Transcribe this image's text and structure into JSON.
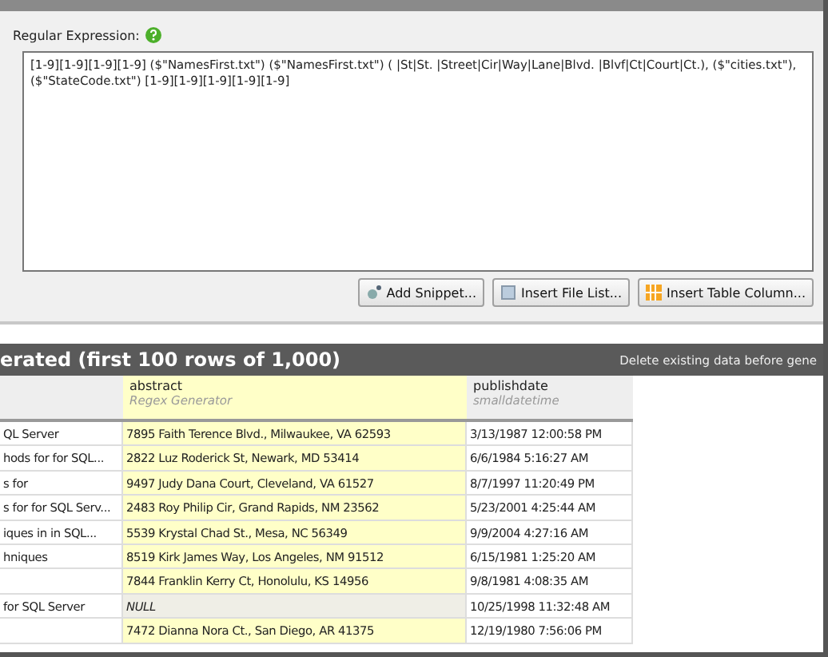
{
  "regex": {
    "label": "Regular Expression:",
    "value": "[1-9][1-9][1-9][1-9] ($\"NamesFirst.txt\") ($\"NamesFirst.txt\") ( |St|St. |Street|Cir|Way|Lane|Blvd. |Blvf|Ct|Court|Ct.), ($\"cities.txt\"), ($\"StateCode.txt\") [1-9][1-9][1-9][1-9][1-9]"
  },
  "buttons": [
    {
      "label": "Add Snippet...",
      "kind": "snippet"
    },
    {
      "label": "Insert File List...",
      "kind": "file"
    },
    {
      "label": "Insert Table  Column...",
      "kind": "table"
    }
  ],
  "preview": {
    "title": "erated (first 100 rows of 1,000)",
    "option": "Delete existing data before gene"
  },
  "columns": [
    {
      "highlighted": false
    },
    {
      "name": "abstract",
      "type": "Regex Generator",
      "highlighted": true
    },
    {
      "name": "publishdate",
      "type": "smalldatetime",
      "highlighted": false
    }
  ],
  "rows": [
    {
      "cells": [
        {
          "text": "QL Server"
        },
        {
          "text": "7895 Faith Terence Blvd., Milwaukee, VA 62593"
        },
        {
          "text": "3/13/1987 12:00:58 PM"
        }
      ]
    },
    {
      "cells": [
        {
          "text": "hods for for SQL..."
        },
        {
          "text": "2822 Luz Roderick St, Newark, MD 53414"
        },
        {
          "text": "6/6/1984 5:16:27 AM"
        }
      ]
    },
    {
      "cells": [
        {
          "text": "s for"
        },
        {
          "text": "9497 Judy Dana Court, Cleveland, VA 61527"
        },
        {
          "text": "8/7/1997 11:20:49 PM"
        }
      ]
    },
    {
      "cells": [
        {
          "text": "s for for SQL Serv..."
        },
        {
          "text": "2483 Roy Philip Cir, Grand Rapids, NM 23562"
        },
        {
          "text": "5/23/2001 4:25:44 AM"
        }
      ]
    },
    {
      "cells": [
        {
          "text": "iques in in SQL..."
        },
        {
          "text": "5539 Krystal Chad St., Mesa, NC 56349"
        },
        {
          "text": "9/9/2004 4:27:16 AM"
        }
      ]
    },
    {
      "cells": [
        {
          "text": "hniques"
        },
        {
          "text": "8519 Kirk James Way, Los Angeles, NM 91512"
        },
        {
          "text": "6/15/1981 1:25:20 AM"
        }
      ]
    },
    {
      "cells": [
        {},
        {
          "text": "7844 Franklin Kerry Ct, Honolulu, KS 14956"
        },
        {
          "text": "9/8/1981 4:08:35 AM"
        }
      ]
    },
    {
      "cells": [
        {
          "text": " for SQL Server"
        },
        {
          "text": "NULL",
          "kind": "null"
        },
        {
          "text": "10/25/1998 11:32:48 AM"
        }
      ]
    },
    {
      "cells": [
        {},
        {
          "text": "7472 Dianna Nora Ct., San Diego, AR 41375"
        },
        {
          "text": "12/19/1980 7:56:06 PM"
        }
      ]
    }
  ]
}
